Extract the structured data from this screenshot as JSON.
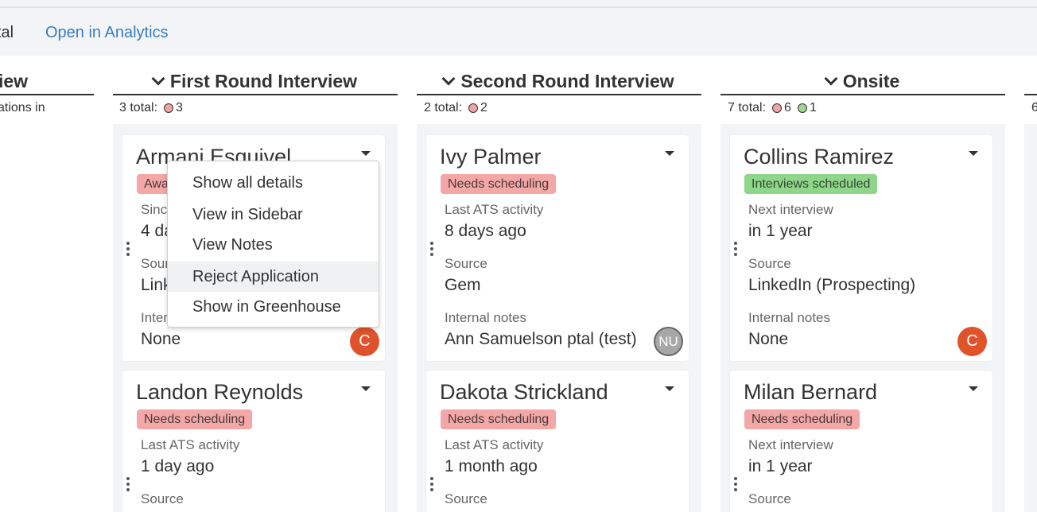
{
  "toolbar": {
    "total_fragment": "tal",
    "analytics_link": "Open in Analytics"
  },
  "columns": [
    {
      "title_fragment": "iew",
      "subtitle_fragment": "ations in"
    },
    {
      "title": "First Round Interview",
      "total_label": "3 total:",
      "counts": [
        {
          "color": "red",
          "value": "3"
        }
      ],
      "cards": [
        {
          "name": "Armani Esquivel",
          "badge": "Awa",
          "field1_label": "Sinc",
          "field1_value": "4 da",
          "field2_label": "Sour",
          "field2_value": "Link",
          "field3_label": "Inter",
          "field3_value": "None",
          "avatar": "C"
        },
        {
          "name": "Landon Reynolds",
          "badge": "Needs scheduling",
          "field1_label": "Last ATS activity",
          "field1_value": "1 day ago",
          "field2_label": "Source"
        }
      ]
    },
    {
      "title": "Second Round Interview",
      "total_label": "2 total:",
      "counts": [
        {
          "color": "red",
          "value": "2"
        }
      ],
      "cards": [
        {
          "name": "Ivy Palmer",
          "badge": "Needs scheduling",
          "field1_label": "Last ATS activity",
          "field1_value": "8 days ago",
          "field2_label": "Source",
          "field2_value": "Gem",
          "field3_label": "Internal notes",
          "field3_value": "Ann Samuelson ptal (test)",
          "avatar": "NU"
        },
        {
          "name": "Dakota Strickland",
          "badge": "Needs scheduling",
          "field1_label": "Last ATS activity",
          "field1_value": "1 month ago",
          "field2_label": "Source"
        }
      ]
    },
    {
      "title": "Onsite",
      "total_label": "7 total:",
      "counts": [
        {
          "color": "red",
          "value": "6"
        },
        {
          "color": "green",
          "value": "1"
        }
      ],
      "cards": [
        {
          "name": "Collins Ramirez",
          "badge": "Interviews scheduled",
          "field1_label": "Next interview",
          "field1_value": "in 1 year",
          "field2_label": "Source",
          "field2_value": "LinkedIn (Prospecting)",
          "field3_label": "Internal notes",
          "field3_value": "None",
          "avatar": "C"
        },
        {
          "name": "Milan Bernard",
          "badge": "Needs scheduling",
          "field1_label": "Next interview",
          "field1_value": "in 1 year",
          "field2_label": "Source"
        }
      ]
    },
    {
      "total_fragment": "6"
    }
  ],
  "context_menu": {
    "items": [
      "Show all details",
      "View in Sidebar",
      "View Notes",
      "Reject Application",
      "Show in Greenhouse"
    ]
  },
  "colors": {
    "link": "#3a7cc1",
    "badge_red": "#f4a7a7",
    "badge_green": "#8fd58a",
    "avatar_orange": "#e0532a"
  }
}
